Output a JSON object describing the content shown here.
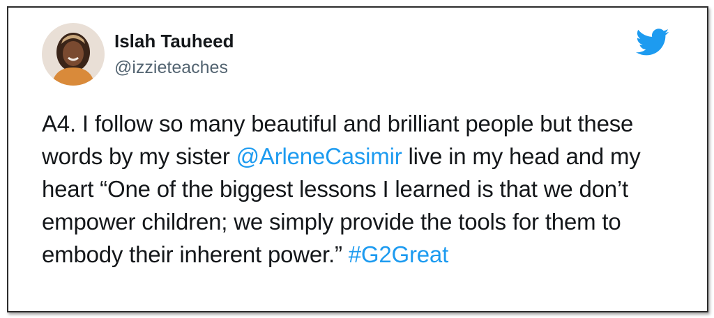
{
  "tweet": {
    "author": {
      "display_name": "Islah Tauheed",
      "handle": "@izzieteaches",
      "avatar_icon": "profile-photo"
    },
    "platform_icon": "twitter-bird-icon",
    "brand_color": "#1d9bf0",
    "body": {
      "part1": "A4. I follow so many beautiful and brilliant people but these words by my sister ",
      "mention": "@ArleneCasimir",
      "part2": " live in my head and my heart “One of the biggest lessons I learned is that we don’t empower children; we simply provide the tools for them to embody their inherent power.” ",
      "hashtag": "#G2Great"
    }
  }
}
